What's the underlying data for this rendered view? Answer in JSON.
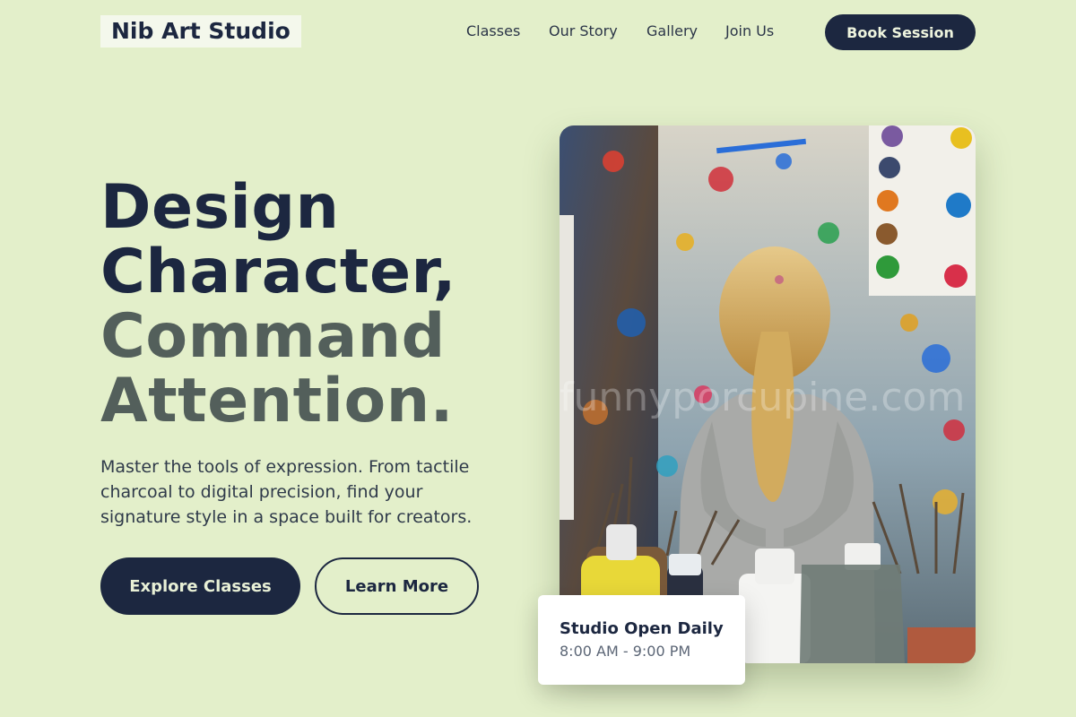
{
  "brand": {
    "name": "Nib Art Studio"
  },
  "nav": {
    "items": [
      {
        "label": "Classes"
      },
      {
        "label": "Our Story"
      },
      {
        "label": "Gallery"
      },
      {
        "label": "Join Us"
      }
    ],
    "cta_label": "Book Session"
  },
  "hero": {
    "headline_line1": "Design",
    "headline_line2": "Character,",
    "headline_line3": "Command",
    "headline_line4": "Attention.",
    "subtitle": "Master the tools of expression. From tactile charcoal to digital precision, find your signature style in a space built for creators.",
    "primary_button": "Explore Classes",
    "secondary_button": "Learn More"
  },
  "hours_card": {
    "title": "Studio Open Daily",
    "time": "8:00 AM - 9:00 PM"
  },
  "photo": {
    "watermark": "funnyporcupine.com"
  },
  "colors": {
    "background": "#e3efca",
    "primary": "#1c2740",
    "muted_heading": "#535f5b"
  }
}
